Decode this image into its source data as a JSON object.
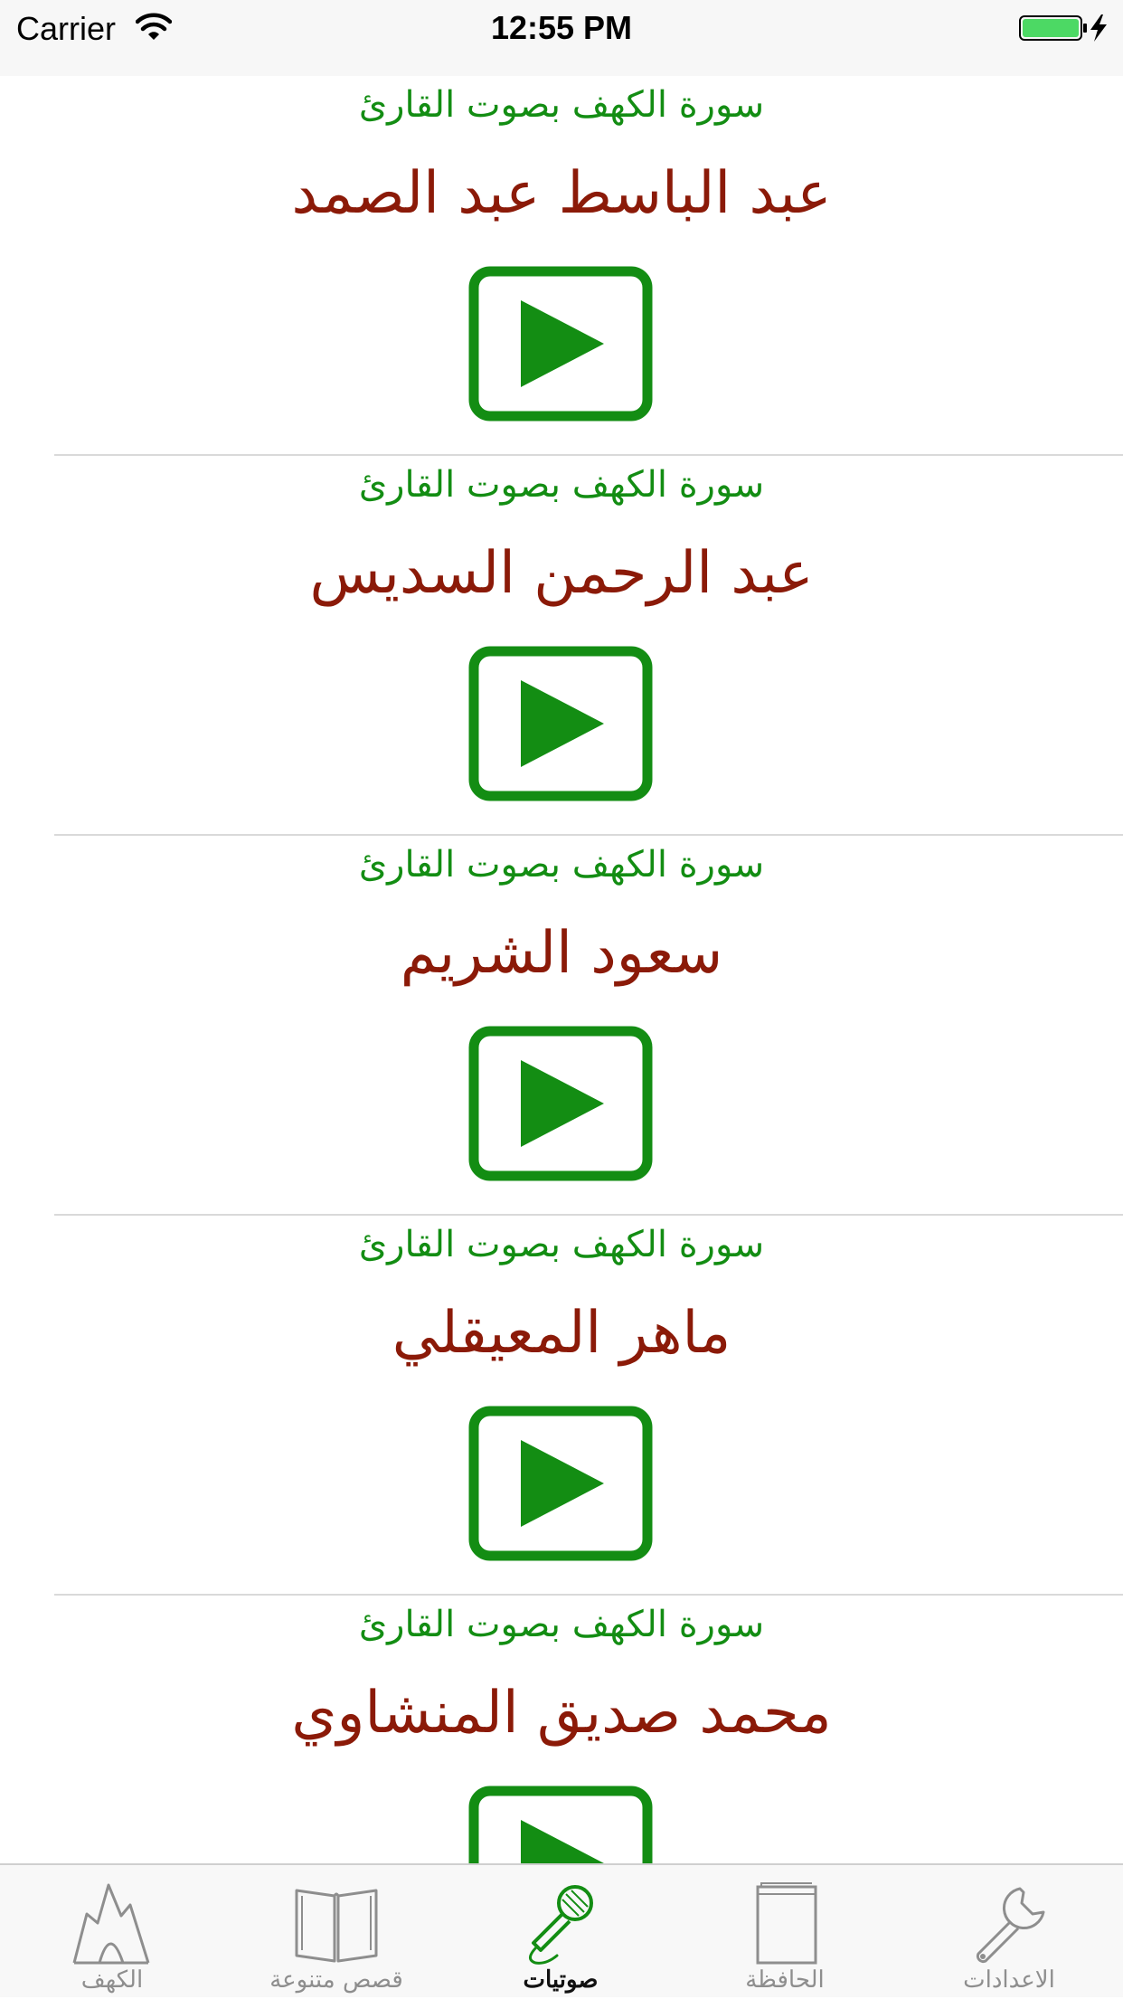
{
  "status_bar": {
    "carrier": "Carrier",
    "time": "12:55 PM",
    "battery_color": "#4cd964"
  },
  "colors": {
    "accent_green": "#138d13",
    "title_red": "#8b1a08",
    "inactive_tab": "#8e8e8e"
  },
  "reciters": [
    {
      "subtitle": "سورة الكهف بصوت القارئ",
      "name": "عبد الباسط عبد الصمد",
      "icon": "play-icon"
    },
    {
      "subtitle": "سورة الكهف بصوت القارئ",
      "name": "عبد الرحمن السديس",
      "icon": "play-icon"
    },
    {
      "subtitle": "سورة الكهف بصوت القارئ",
      "name": "سعود الشريم",
      "icon": "play-icon"
    },
    {
      "subtitle": "سورة الكهف بصوت القارئ",
      "name": "ماهر المعيقلي",
      "icon": "play-icon"
    },
    {
      "subtitle": "سورة الكهف بصوت القارئ",
      "name": "محمد صديق المنشاوي",
      "icon": "play-icon"
    }
  ],
  "tab_bar": {
    "tabs": [
      {
        "label": "الكهف",
        "icon": "cave-icon",
        "active": false
      },
      {
        "label": "قصص متنوعة",
        "icon": "book-icon",
        "active": false
      },
      {
        "label": "صوتيات",
        "icon": "microphone-icon",
        "active": true
      },
      {
        "label": "الحافظة",
        "icon": "folder-icon",
        "active": false
      },
      {
        "label": "الاعدادات",
        "icon": "wrench-icon",
        "active": false
      }
    ]
  }
}
